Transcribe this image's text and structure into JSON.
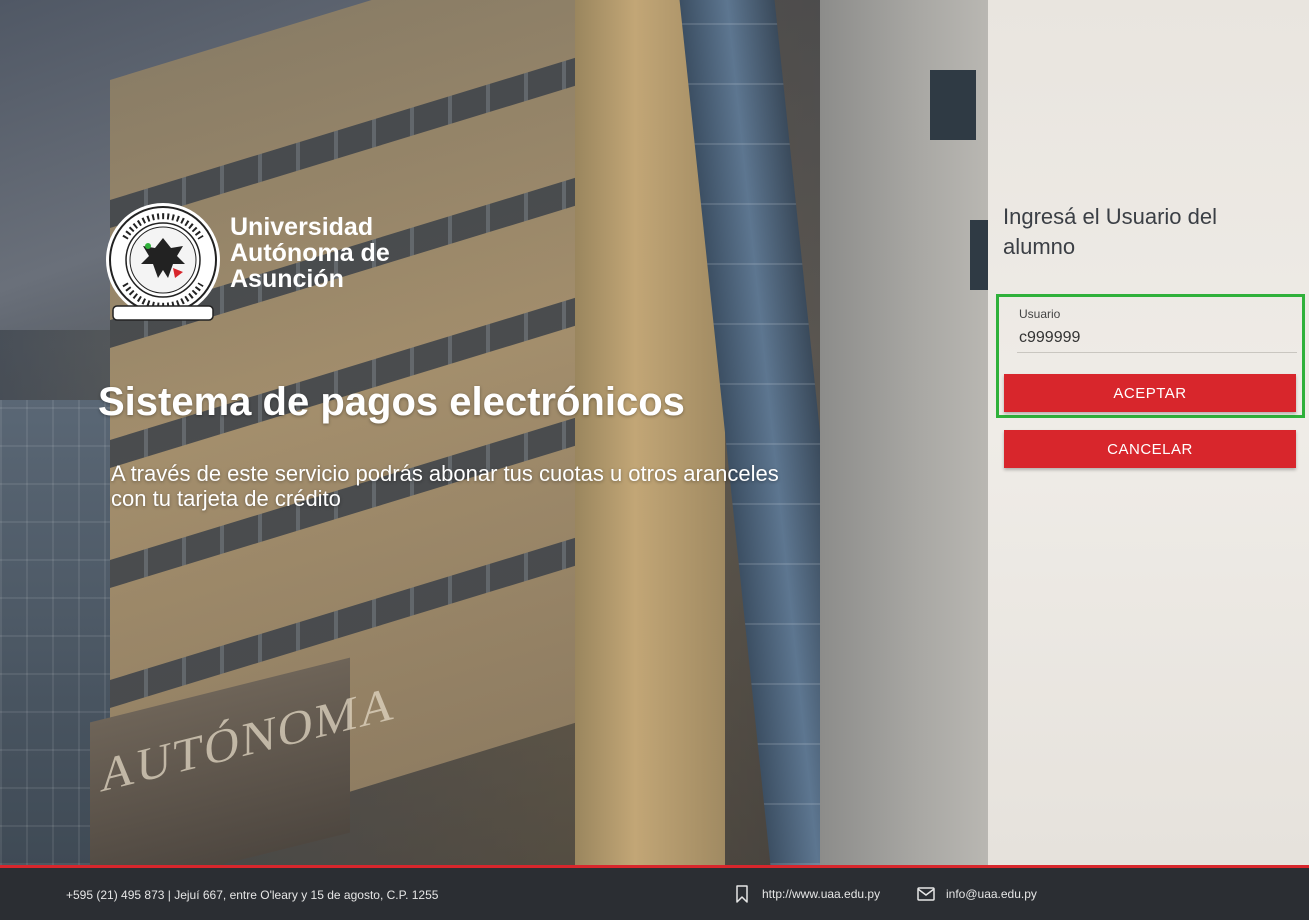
{
  "brand": {
    "university_name": [
      "Universidad",
      "Autónoma de",
      "Asunción"
    ]
  },
  "hero": {
    "headline": "Sistema de pagos electrónicos",
    "subcopy": "A través de este servicio podrás abonar tus cuotas u otros aranceles con tu tarjeta de crédito"
  },
  "login": {
    "title": "Ingresá el Usuario del alumno",
    "user_label": "Usuario",
    "user_value": "c999999",
    "accept_label": "ACEPTAR",
    "cancel_label": "CANCELAR"
  },
  "footer": {
    "address": "+595 (21) 495 873 | Jejuí 667, entre O'leary y 15 de agosto, C.P. 1255",
    "website": "http://www.uaa.edu.py",
    "email": "info@uaa.edu.py"
  },
  "colors": {
    "accent_red": "#d8262c",
    "focus_green": "#2fb13a",
    "footer_bg": "#2b2e33"
  }
}
